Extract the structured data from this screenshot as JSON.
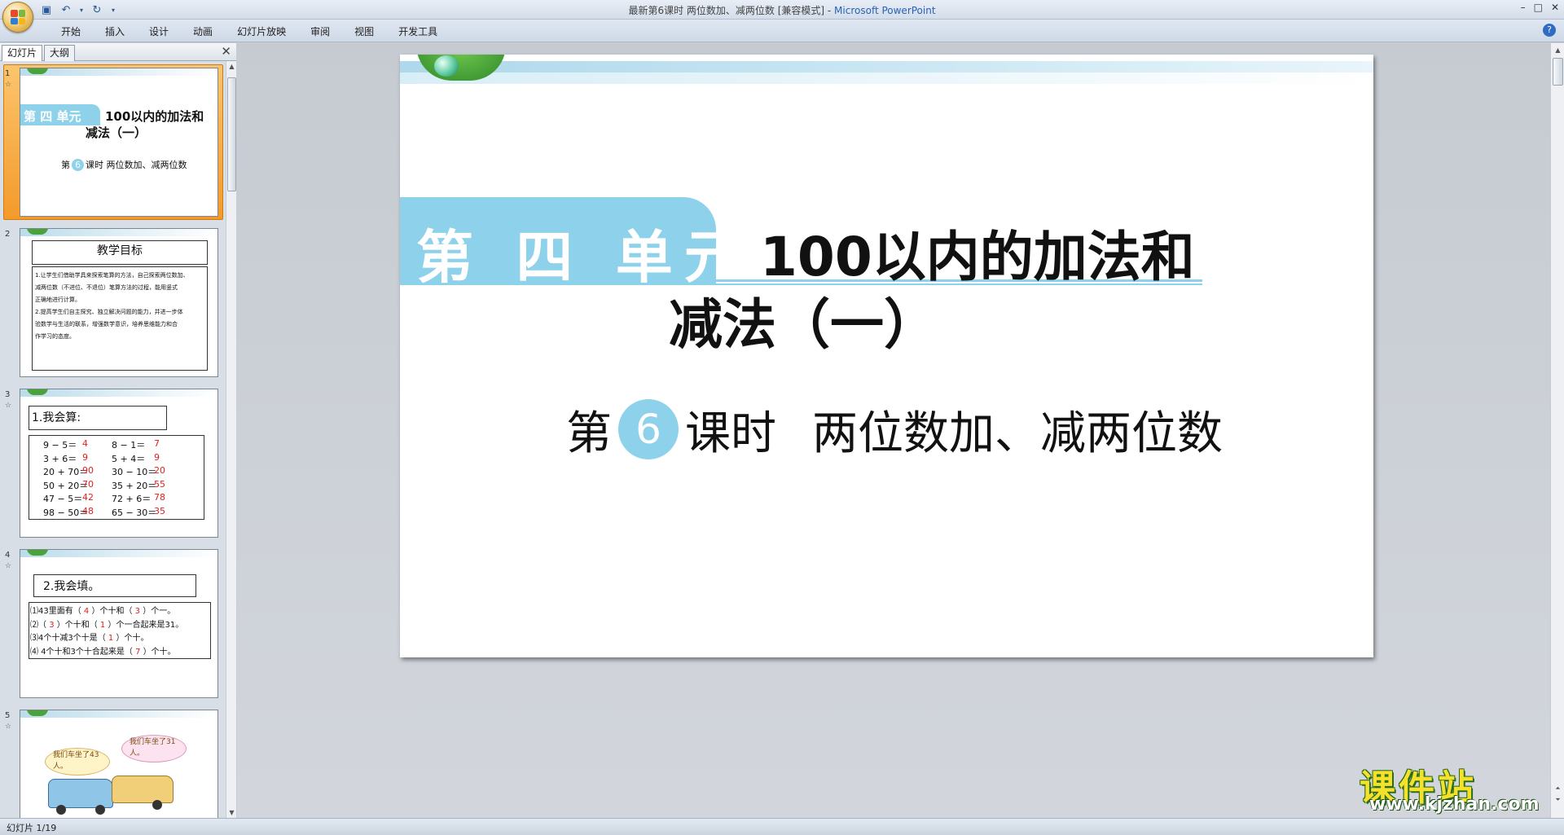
{
  "window": {
    "doc_title": "最新第6课时   两位数加、减两位数 [兼容模式] - ",
    "app_name": "Microsoft PowerPoint",
    "controls": [
      "–",
      "□",
      "✕"
    ]
  },
  "ribbon": {
    "tabs": [
      "开始",
      "插入",
      "设计",
      "动画",
      "幻灯片放映",
      "审阅",
      "视图",
      "开发工具"
    ],
    "help": "?"
  },
  "left_pane": {
    "tabs": [
      "幻灯片",
      "大纲"
    ],
    "close": "✕",
    "thumbs": [
      {
        "num": "1",
        "unit": "第 四 单元",
        "title1": "100以内的加法和",
        "title2": "减法（一）",
        "lesson_pre": "第",
        "lesson_num": "6",
        "lesson_post": "课时   两位数加、减两位数"
      },
      {
        "num": "2",
        "heading": "教学目标",
        "lines": [
          "1.让学生们借助学具来探索笔算的方法，自己探索两位数加、",
          "减两位数（不进位、不退位）笔算方法的过程，能用竖式",
          "正确地进行计算。",
          "2.提高学生们自主探究、独立解决问题的能力，并进一步体",
          "验数学与生活的联系，增强数学意识，培养思维能力和合",
          "作学习的态度。"
        ]
      },
      {
        "num": "3",
        "heading": "1.我会算:",
        "rows": [
          {
            "a": "9 − 5＝",
            "ar": "4",
            "b": "8 − 1＝ ",
            "br": "7"
          },
          {
            "a": "3 + 6＝ ",
            "ar": "9",
            "b": "5 + 4＝ ",
            "br": "9"
          },
          {
            "a": "20 + 70＝",
            "ar": "90",
            "b": "30 − 10＝",
            "br": "20"
          },
          {
            "a": "50 + 20＝",
            "ar": "70",
            "b": "35 + 20＝ ",
            "br": "55"
          },
          {
            "a": "47 − 5＝",
            "ar": "42",
            "b": "72 + 6＝",
            "br": "78"
          },
          {
            "a": "98 − 50＝",
            "ar": "48",
            "b": "65 − 30＝",
            "br": "35"
          }
        ]
      },
      {
        "num": "4",
        "heading": "2.我会填。",
        "lines": [
          {
            "pre": "⑴43里面有（ ",
            "r1": "4",
            "mid": " ）个十和（ ",
            "r2": "3",
            "post": " ）个一。"
          },
          {
            "pre": "⑵（ ",
            "r1": "3",
            "mid": " ）个十和（ ",
            "r2": "1",
            "post": " ）个一合起来是31。"
          },
          {
            "pre": "⑶4个十减3个十是（ ",
            "r1": "1",
            "mid": " ）个十。",
            "r2": "",
            "post": ""
          },
          {
            "pre": "⑷ 4个十和3个十合起来是（ ",
            "r1": "7",
            "mid": " ）个十。",
            "r2": "",
            "post": ""
          }
        ]
      },
      {
        "num": "5",
        "bubble1": "我们车坐了43人。",
        "bubble2": "我们车坐了31人。"
      }
    ]
  },
  "slide": {
    "unit": "第 四 单元",
    "title_line1": "100以内的加法和",
    "title_line2": "减法（一）",
    "lesson_pre": "第",
    "lesson_num": "6",
    "lesson_post": "课时",
    "lesson_topic": "两位数加、减两位数",
    "accent_color": "#8dd1ea"
  },
  "watermark": {
    "main": "课件站",
    "url": "www.kjzhan.com"
  },
  "status": {
    "slide_indicator": "幻灯片 1/19"
  }
}
